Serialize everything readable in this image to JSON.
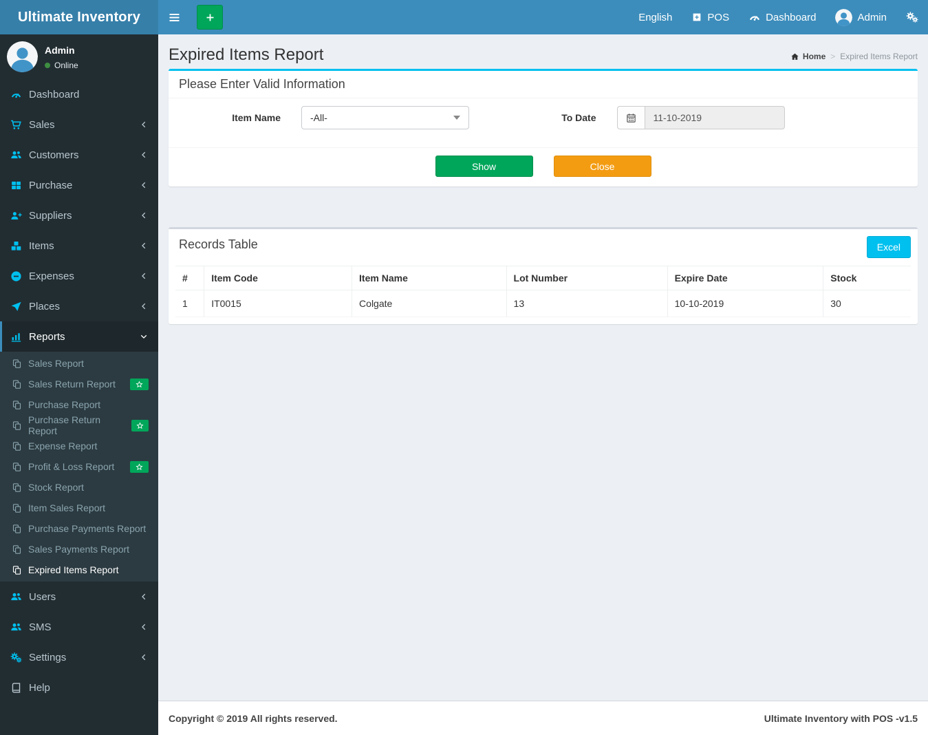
{
  "app": {
    "title": "Ultimate Inventory"
  },
  "navbar": {
    "language": "English",
    "pos": "POS",
    "dashboard": "Dashboard",
    "user": "Admin"
  },
  "sidebar": {
    "user": {
      "name": "Admin",
      "status": "Online"
    },
    "menu": [
      "Dashboard",
      "Sales",
      "Customers",
      "Purchase",
      "Suppliers",
      "Items",
      "Expenses",
      "Places"
    ],
    "reports_label": "Reports",
    "reports_items": [
      "Sales Report",
      "Sales Return Report",
      "Purchase Report",
      "Purchase Return Report",
      "Expense Report",
      "Profit & Loss Report",
      "Stock Report",
      "Item Sales Report",
      "Purchase Payments Report",
      "Sales Payments Report",
      "Expired Items Report"
    ],
    "menu2": [
      "Users",
      "SMS",
      "Settings",
      "Help"
    ]
  },
  "header": {
    "title": "Expired Items Report",
    "home": "Home",
    "sep": ">",
    "current": "Expired Items Report"
  },
  "filter": {
    "title": "Please Enter Valid Information",
    "item_name_label": "Item Name",
    "item_name_value": "-All-",
    "to_date_label": "To Date",
    "to_date_value": "11-10-2019",
    "show": "Show",
    "close": "Close"
  },
  "records": {
    "title": "Records Table",
    "excel": "Excel",
    "headers": [
      "#",
      "Item Code",
      "Item Name",
      "Lot Number",
      "Expire Date",
      "Stock"
    ],
    "rows": [
      [
        "1",
        "IT0015",
        "Colgate",
        "13",
        "10-10-2019",
        "30"
      ]
    ]
  },
  "footer": {
    "left": "Copyright © 2019 All rights reserved.",
    "right": "Ultimate Inventory with POS -v1.5"
  },
  "colors": {
    "navbar": "#3c8dbc",
    "logo_bg": "#367fa9",
    "sidebar_bg": "#222d32",
    "submenu_bg": "#2c3b41",
    "sidebar_icon": "#00c0ef",
    "success": "#00a65a",
    "warning": "#f39c12",
    "info": "#00c0ef",
    "content_bg": "#ecf0f5"
  }
}
